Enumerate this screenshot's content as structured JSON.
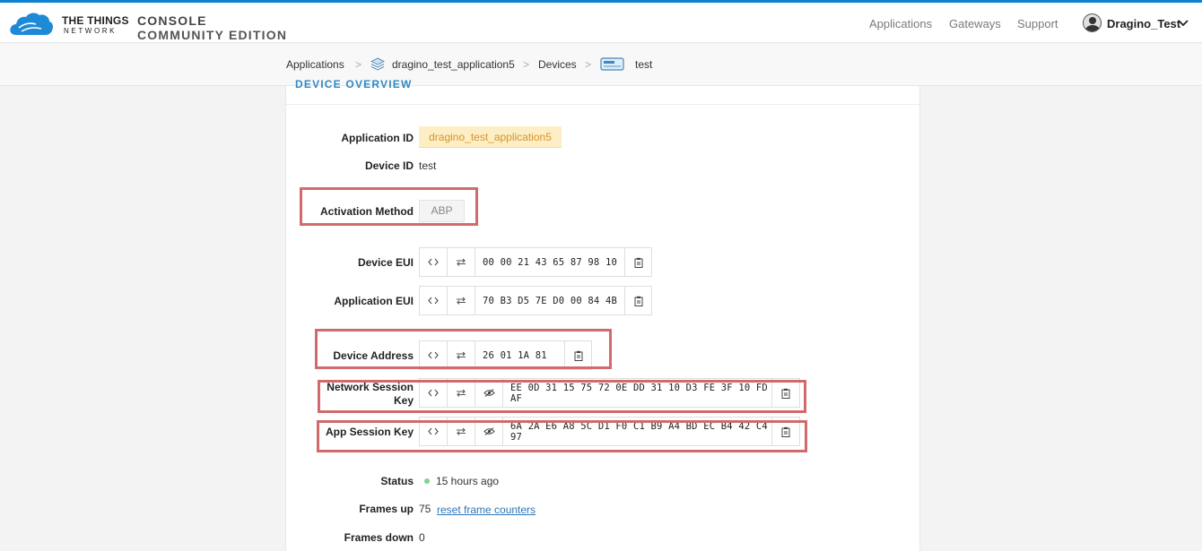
{
  "header": {
    "brand_line1": "THE THINGS",
    "brand_line2": "NETWORK",
    "console_line1": "CONSOLE",
    "console_line2": "COMMUNITY EDITION",
    "nav": {
      "applications": "Applications",
      "gateways": "Gateways",
      "support": "Support"
    },
    "username": "Dragino_Test"
  },
  "breadcrumb": {
    "applications": "Applications",
    "application": "dragino_test_application5",
    "devices": "Devices",
    "device": "test",
    "separator": ">"
  },
  "card": {
    "title": "DEVICE OVERVIEW",
    "application_id_label": "Application ID",
    "application_id": "dragino_test_application5",
    "device_id_label": "Device ID",
    "device_id": "test",
    "activation_method_label": "Activation Method",
    "activation_method": "ABP",
    "device_eui_label": "Device EUI",
    "device_eui": "00 00 21 43 65 87 98 10",
    "application_eui_label": "Application EUI",
    "application_eui": "70 B3 D5 7E D0 00 84 4B",
    "device_address_label": "Device Address",
    "device_address": "26 01 1A 81",
    "network_session_key_label_1": "Network Session",
    "network_session_key_label_2": "Key",
    "network_session_key": "EE 0D 31 15 75 72 0E DD 31 10 D3 FE 3F 10 FD AF",
    "app_session_key_label": "App Session Key",
    "app_session_key": "6A 2A E6 A8 5C D1 F0 C1 B9 A4 BD EC B4 42 C4 97",
    "status_label": "Status",
    "status": "15 hours ago",
    "frames_up_label": "Frames up",
    "frames_up": "75",
    "reset_link": "reset frame counters",
    "frames_down_label": "Frames down",
    "frames_down": "0"
  },
  "colors": {
    "accent": "#0d83d0",
    "highlight": "#d26a6c",
    "app_tag_bg": "#fdeec6",
    "status_dot": "#7fd58a"
  }
}
